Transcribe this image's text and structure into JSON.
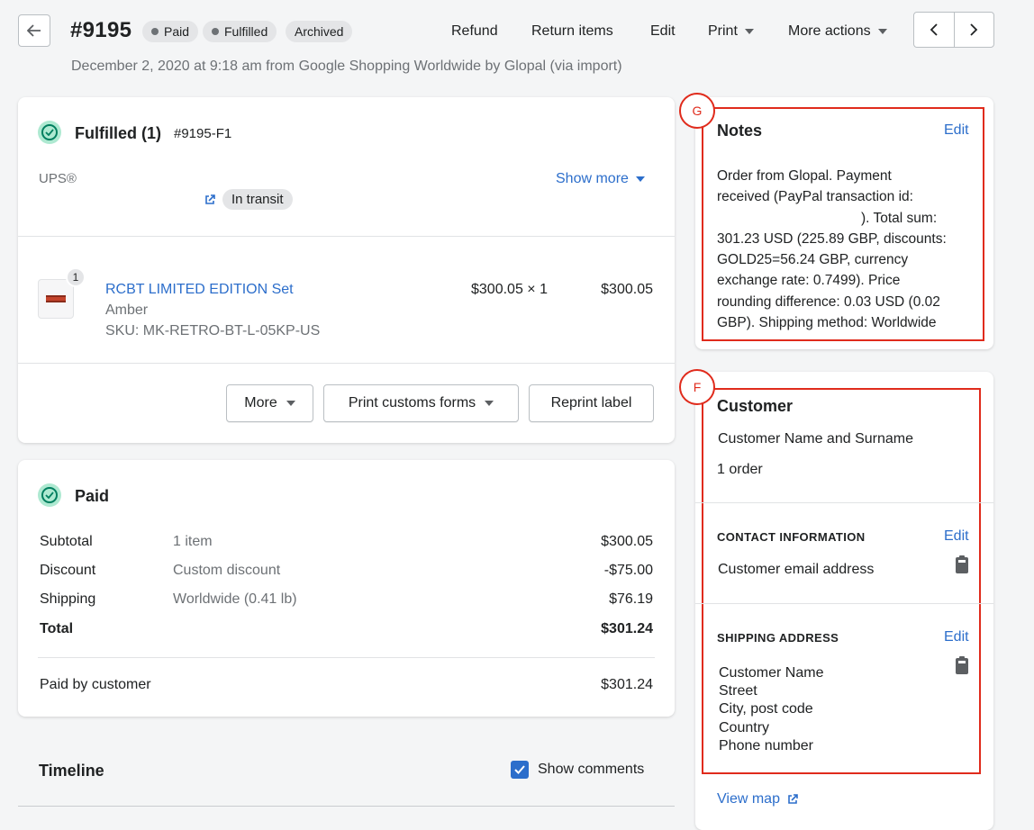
{
  "header": {
    "order_number": "#9195",
    "badges": [
      "Paid",
      "Fulfilled",
      "Archived"
    ],
    "actions": {
      "refund": "Refund",
      "return_items": "Return items",
      "edit": "Edit",
      "print": "Print",
      "more_actions": "More actions"
    },
    "subline": "December 2, 2020 at 9:18 am from Google Shopping Worldwide by Glopal (via import)"
  },
  "fulfilled": {
    "title": "Fulfilled (1)",
    "id": "#9195-F1",
    "carrier": "UPS®",
    "show_more": "Show more",
    "status_pill": "In transit",
    "item": {
      "qty_badge": "1",
      "name": "RCBT LIMITED EDITION Set",
      "variant": "Amber",
      "sku": "SKU: MK-RETRO-BT-L-05KP-US",
      "unit_price": "$300.05 × 1",
      "total": "$300.05"
    },
    "buttons": {
      "more": "More",
      "print_customs": "Print customs forms",
      "reprint": "Reprint label"
    }
  },
  "paid": {
    "title": "Paid",
    "rows": [
      {
        "label": "Subtotal",
        "desc": "1 item",
        "value": "$300.05"
      },
      {
        "label": "Discount",
        "desc": "Custom discount",
        "value": "-$75.00"
      },
      {
        "label": "Shipping",
        "desc": "Worldwide (0.41 lb)",
        "value": "$76.19"
      },
      {
        "label": "Total",
        "desc": "",
        "value": "$301.24"
      }
    ],
    "paid_by_label": "Paid by customer",
    "paid_by_value": "$301.24"
  },
  "timeline": {
    "title": "Timeline",
    "show_comments": "Show comments"
  },
  "notes": {
    "marker": "G",
    "title": "Notes",
    "edit": "Edit",
    "lines": [
      "Order from Glopal. Payment",
      "received (PayPal transaction id:",
      "). Total sum:",
      "301.23 USD (225.89 GBP, discounts:",
      "GOLD25=56.24 GBP, currency",
      "exchange rate: 0.7499). Price",
      "rounding difference: 0.03 USD (0.02",
      "GBP). Shipping method: Worldwide"
    ]
  },
  "customer": {
    "marker": "F",
    "title": "Customer",
    "name": "Customer Name and Surname",
    "orders": "1 order",
    "contact_head": "CONTACT INFORMATION",
    "contact_edit": "Edit",
    "email": "Customer email address",
    "shipping_head": "SHIPPING ADDRESS",
    "shipping_edit": "Edit",
    "address": [
      "Customer Name",
      "Street",
      "City, post code",
      "Country",
      "Phone number"
    ],
    "view_map": "View map"
  },
  "colors": {
    "accent": "#2c6ecb",
    "success": "#007f5f",
    "annotation": "#e02b1c"
  }
}
